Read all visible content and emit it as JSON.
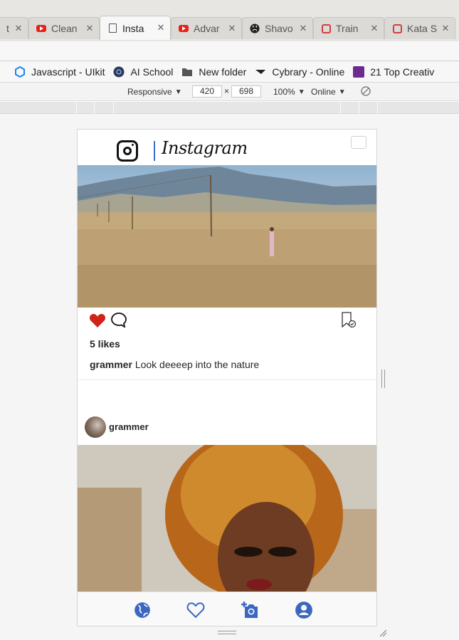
{
  "browser": {
    "tabs": [
      {
        "title": "t",
        "icon": "partial-tab-icon"
      },
      {
        "title": "Clean",
        "icon": "youtube-icon"
      },
      {
        "title": "Insta",
        "icon": "document-icon",
        "active": true
      },
      {
        "title": "Advar",
        "icon": "youtube-icon"
      },
      {
        "title": "Shavo",
        "icon": "github-icon"
      },
      {
        "title": "Train",
        "icon": "codepen-icon"
      },
      {
        "title": "Kata S",
        "icon": "codepen-icon"
      }
    ],
    "bookmarks": [
      {
        "label": "Javascript - UIkit",
        "icon": "uikit-icon"
      },
      {
        "label": "AI School",
        "icon": "ai-school-icon"
      },
      {
        "label": "New folder",
        "icon": "folder-icon"
      },
      {
        "label": "Cybrary - Online",
        "icon": "cybrary-icon"
      },
      {
        "label": "21 Top Creativ",
        "icon": "colorlib-icon"
      }
    ]
  },
  "devtools": {
    "device": "Responsive",
    "width": "420",
    "times": "×",
    "height": "698",
    "zoom": "100%",
    "throttle": "Online"
  },
  "instagram": {
    "wordmark": "Instagram",
    "post1": {
      "likes": "5 likes",
      "caption_user": "grammer",
      "caption_text": "Look deeeep into the nature"
    },
    "post2": {
      "username": "grammer"
    },
    "nav": [
      "globe-icon",
      "heart-outline-icon",
      "add-photo-icon",
      "account-icon"
    ]
  },
  "colors": {
    "heart": "#d0241a",
    "nav_icons": "#3b67c0",
    "divider": "#3b6fd0"
  }
}
